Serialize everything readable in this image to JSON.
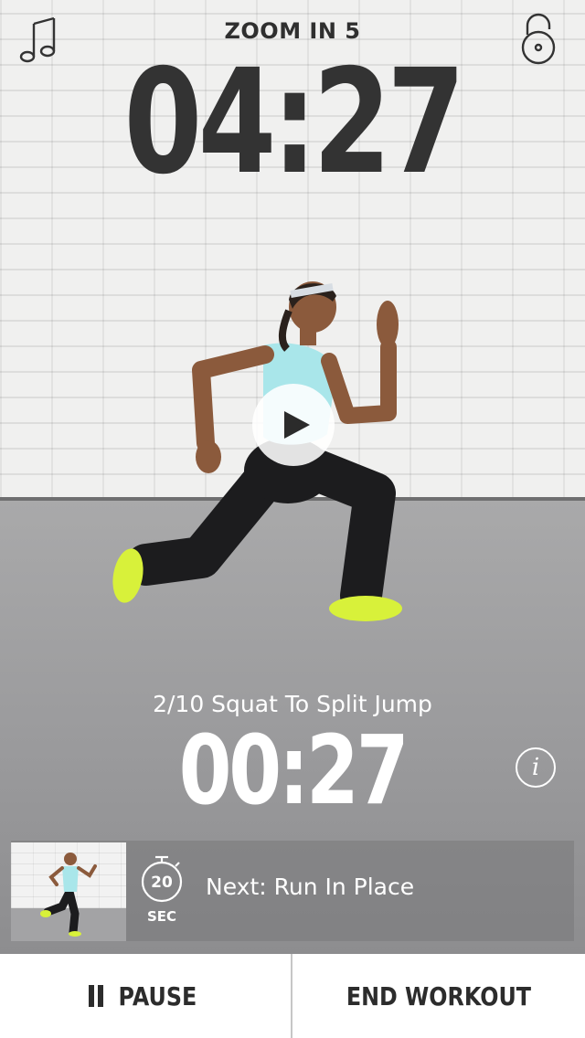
{
  "header": {
    "zoom_label": "ZOOM IN 5",
    "main_timer": "04:27",
    "music_icon": "music-note-icon",
    "lock_icon": "lock-icon"
  },
  "exercise": {
    "name": "2/10 Squat To Split Jump",
    "timer": "00:27",
    "info_icon": "info-icon",
    "info_glyph": "i"
  },
  "next": {
    "label": "Next: Run In Place",
    "duration_value": "20",
    "duration_unit": "SEC"
  },
  "controls": {
    "pause_label": "PAUSE",
    "end_label": "END WORKOUT"
  },
  "colors": {
    "timer_dark": "#333333",
    "overlay_text": "#ffffff",
    "shoe_accent": "#d8f13a",
    "top_accent": "#a9e6ea"
  }
}
